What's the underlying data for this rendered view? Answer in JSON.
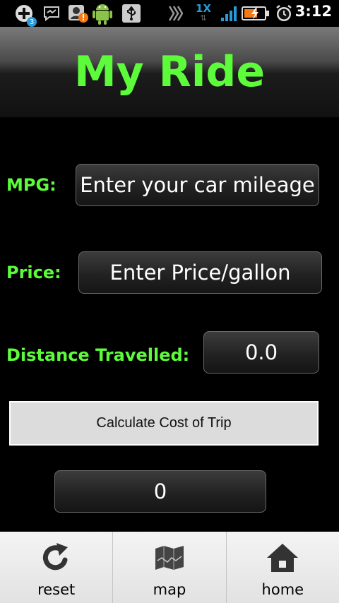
{
  "status_bar": {
    "time": "3:12",
    "notification_badge": "3",
    "network_label": "1X",
    "icons": [
      "plus-notification-icon",
      "messenger-icon",
      "contact-alert-icon",
      "android-icon",
      "usb-icon",
      "signal-waves-icon",
      "network-1x-icon",
      "signal-strength-icon",
      "battery-charging-icon",
      "alarm-clock-icon"
    ]
  },
  "app": {
    "title": "My Ride",
    "accent_color": "#5dfc3a"
  },
  "form": {
    "mpg_label": "MPG:",
    "mpg_placeholder": "Enter your car mileage",
    "price_label": "Price:",
    "price_placeholder": "Enter Price/gallon",
    "distance_label": "Distance Travelled:",
    "distance_value": "0.0",
    "calculate_label": "Calculate Cost of Trip",
    "result_value": "0"
  },
  "bottom_nav": {
    "items": [
      {
        "label": "reset",
        "icon": "refresh-icon"
      },
      {
        "label": "map",
        "icon": "map-icon"
      },
      {
        "label": "home",
        "icon": "home-icon"
      }
    ]
  }
}
